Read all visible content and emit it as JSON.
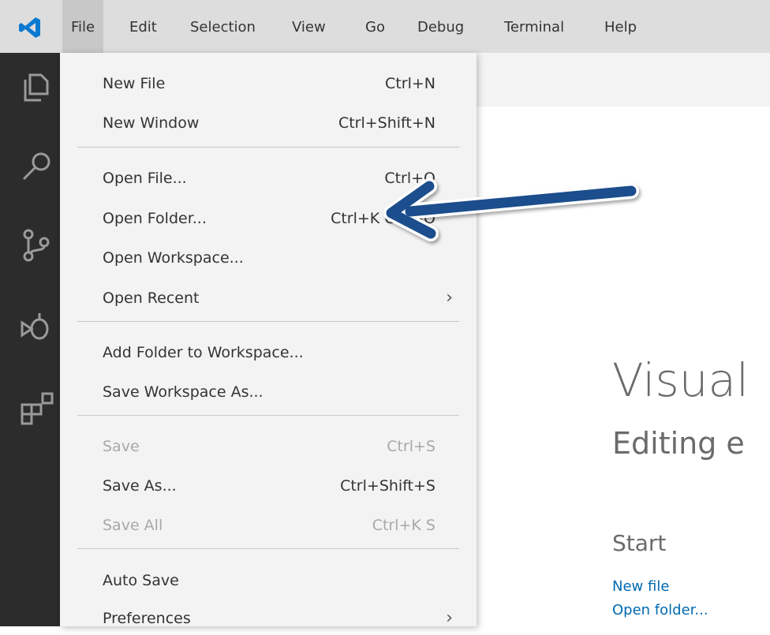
{
  "menubar": {
    "items": [
      "File",
      "Edit",
      "Selection",
      "View",
      "Go",
      "Debug",
      "Terminal",
      "Help"
    ],
    "active": "File"
  },
  "file_menu": {
    "new_file": {
      "label": "New File",
      "shortcut": "Ctrl+N"
    },
    "new_window": {
      "label": "New Window",
      "shortcut": "Ctrl+Shift+N"
    },
    "open_file": {
      "label": "Open File...",
      "shortcut": "Ctrl+O"
    },
    "open_folder": {
      "label": "Open Folder...",
      "shortcut": "Ctrl+K Ctrl+O"
    },
    "open_workspace": {
      "label": "Open Workspace..."
    },
    "open_recent": {
      "label": "Open Recent"
    },
    "add_folder": {
      "label": "Add Folder to Workspace..."
    },
    "save_workspace_as": {
      "label": "Save Workspace As..."
    },
    "save": {
      "label": "Save",
      "shortcut": "Ctrl+S",
      "disabled": true
    },
    "save_as": {
      "label": "Save As...",
      "shortcut": "Ctrl+Shift+S"
    },
    "save_all": {
      "label": "Save All",
      "shortcut": "Ctrl+K S",
      "disabled": true
    },
    "auto_save": {
      "label": "Auto Save"
    },
    "preferences": {
      "label": "Preferences"
    }
  },
  "welcome": {
    "title": "Visual",
    "subtitle": "Editing e",
    "start_heading": "Start",
    "links": [
      "New file",
      "Open folder..."
    ]
  },
  "activity_icons": [
    "explorer-icon",
    "search-icon",
    "source-control-icon",
    "debug-icon",
    "extensions-icon"
  ],
  "colors": {
    "accent": "#006ab1",
    "arrow": "#1f4e8c",
    "activity_bar": "#2c2c2c",
    "menubar": "#dddddd"
  }
}
